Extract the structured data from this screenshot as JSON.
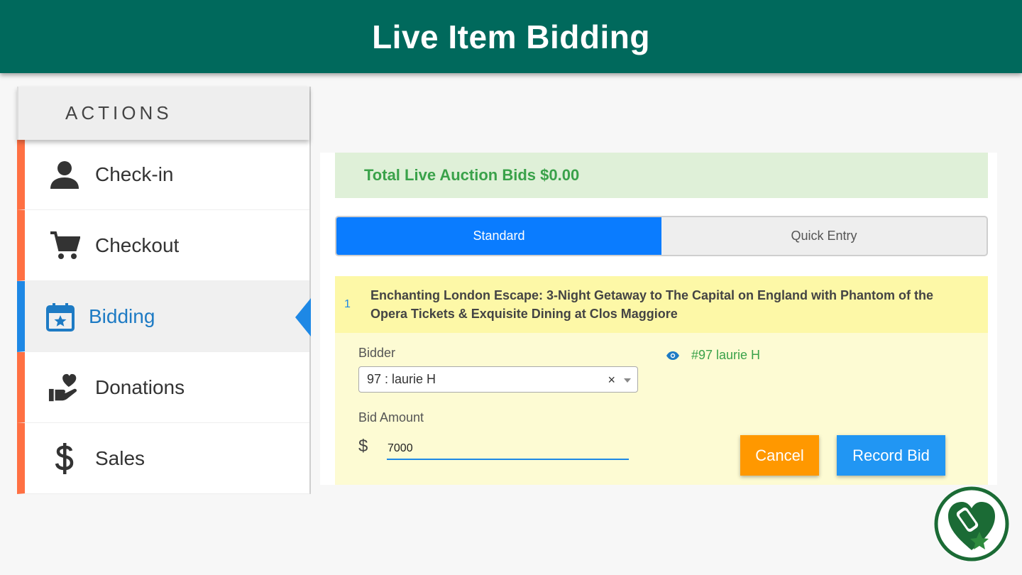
{
  "banner": {
    "title": "Live Item Bidding"
  },
  "sidebar": {
    "heading": "ACTIONS",
    "items": [
      {
        "label": "Check-in",
        "icon": "person-icon",
        "active": false
      },
      {
        "label": "Checkout",
        "icon": "cart-icon",
        "active": false
      },
      {
        "label": "Bidding",
        "icon": "calendar-star-icon",
        "active": true
      },
      {
        "label": "Donations",
        "icon": "hand-heart-icon",
        "active": false
      },
      {
        "label": "Sales",
        "icon": "dollar-icon",
        "active": false
      }
    ]
  },
  "main": {
    "total_text": "Total Live Auction Bids $0.00",
    "tabs": [
      {
        "label": "Standard",
        "selected": true
      },
      {
        "label": "Quick Entry",
        "selected": false
      }
    ],
    "item": {
      "number": "1",
      "title": "Enchanting London Escape: 3-Night Getaway to The Capital on England with Phantom of the Opera Tickets & Exquisite Dining at Clos Maggiore"
    },
    "form": {
      "bidder_label": "Bidder",
      "bidder_value": "97 : laurie H",
      "clear_symbol": "×",
      "bidder_info": "#97 laurie H",
      "amount_label": "Bid Amount",
      "currency_symbol": "$",
      "amount_value": "7000",
      "cancel_label": "Cancel",
      "record_label": "Record Bid"
    }
  },
  "colors": {
    "banner": "#00695c",
    "accent_orange": "#ff7043",
    "active_blue": "#1e88e5",
    "total_green_text": "#3aa24a",
    "cancel": "#ff9800",
    "record": "#2196f3"
  }
}
